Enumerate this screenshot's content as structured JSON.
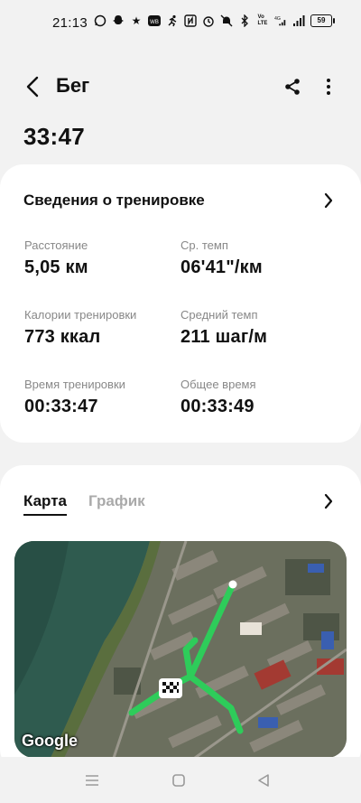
{
  "status_bar": {
    "time": "21:13",
    "battery": "59",
    "left_icons": [
      "whatsapp-icon",
      "snapchat-icon",
      "star-icon",
      "wb-icon",
      "running-icon"
    ],
    "right_icons": [
      "nfc-icon",
      "alarm-icon",
      "mute-icon",
      "bluetooth-icon",
      "volte-icon",
      "signal-4g-icon",
      "signal-icon"
    ]
  },
  "header": {
    "title": "Бег",
    "duration": "33:47"
  },
  "workout_info": {
    "title": "Сведения о тренировке",
    "metrics": [
      {
        "label": "Расстояние",
        "value": "5,05 км"
      },
      {
        "label": "Ср. темп",
        "value": "06'41\"/км"
      },
      {
        "label": "Калории тренировки",
        "value": "773 ккал"
      },
      {
        "label": "Средний темп",
        "value": "211 шаг/м"
      },
      {
        "label": "Время тренировки",
        "value": "00:33:47"
      },
      {
        "label": "Общее время",
        "value": "00:33:49"
      }
    ]
  },
  "map_section": {
    "tabs": [
      {
        "label": "Карта",
        "active": true
      },
      {
        "label": "График",
        "active": false
      }
    ],
    "attribution": "Google"
  },
  "colors": {
    "background": "#f2f2f2",
    "card": "#ffffff",
    "route": "#2ecc5a"
  }
}
